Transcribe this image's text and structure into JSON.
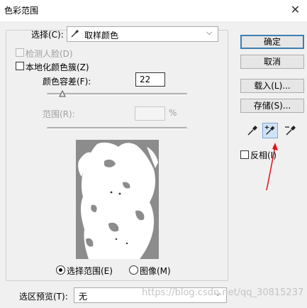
{
  "window": {
    "title": "色彩范围",
    "close_glyph": "✕"
  },
  "select": {
    "label": "选择(C):",
    "value": "取样颜色",
    "icon": "eyedropper-icon",
    "arrow": "⌵"
  },
  "checkboxes": {
    "detect_faces": {
      "label": "检测人脸(D)",
      "checked": false,
      "enabled": false
    },
    "localized": {
      "label": "本地化颜色簇(Z)",
      "checked": false,
      "enabled": true
    }
  },
  "fuzziness": {
    "label": "颜色容差(F):",
    "value": "22",
    "slider_fraction": 0.11
  },
  "range": {
    "label": "范围(R):",
    "value": "",
    "unit": "%",
    "enabled": false
  },
  "preview_mode": {
    "selection": {
      "label": "选择范围(E)",
      "selected": true
    },
    "image": {
      "label": "图像(M)",
      "selected": false
    }
  },
  "selection_preview": {
    "label": "选区预览(T):",
    "value": "无",
    "arrow": "⌵"
  },
  "buttons": {
    "ok": "确定",
    "cancel": "取消",
    "load": "载入(L)...",
    "save": "存储(S)..."
  },
  "eyedroppers": [
    {
      "icon": "eyedropper-icon",
      "selected": false
    },
    {
      "icon": "eyedropper-plus-icon",
      "selected": true
    },
    {
      "icon": "eyedropper-minus-icon",
      "selected": false
    }
  ],
  "invert": {
    "label": "反相(I)",
    "checked": false
  },
  "watermark": "https://blog.csdn.net/qq_30815237",
  "colors": {
    "accent": "#3c7fb1",
    "annotation_arrow": "#e0101a",
    "preview_bg": "#8c8c8c"
  }
}
